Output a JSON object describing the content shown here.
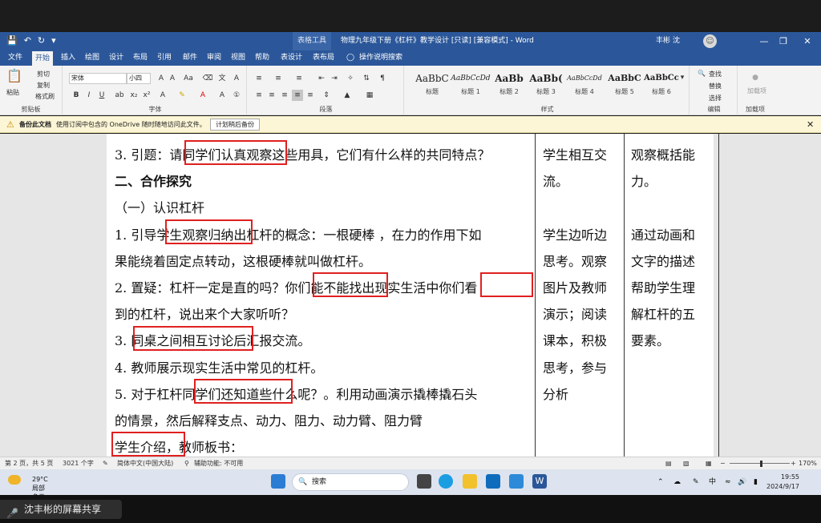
{
  "titlebar": {
    "context_tab": "表格工具",
    "doc_title": "物理九年级下册《杠杆》教学设计 [只读] [兼容模式] - Word",
    "user": "丰彬 沈",
    "minimize": "—",
    "restore": "❐",
    "close": "✕"
  },
  "tabs": [
    "文件",
    "开始",
    "插入",
    "绘图",
    "设计",
    "布局",
    "引用",
    "邮件",
    "审阅",
    "视图",
    "帮助",
    "表设计",
    "表布局"
  ],
  "tell_me": "操作说明搜索",
  "ribbon": {
    "clipboard": {
      "label": "剪贴板",
      "paste": "粘贴",
      "cut": "剪切",
      "copy": "复制",
      "format_painter": "格式刷"
    },
    "font": {
      "label": "字体",
      "font_name": "宋体",
      "font_size": "小四"
    },
    "paragraph": {
      "label": "段落"
    },
    "styles": {
      "label": "样式",
      "items": [
        {
          "preview": "AaBbC",
          "name": "标题"
        },
        {
          "preview": "AaBbCcDd",
          "name": "标题 1"
        },
        {
          "preview": "AaBb",
          "name": "标题 2"
        },
        {
          "preview": "AaBb(",
          "name": "标题 3"
        },
        {
          "preview": "AaBbCcDd",
          "name": "标题 4"
        },
        {
          "preview": "AaBbC",
          "name": "标题 5"
        },
        {
          "preview": "AaBbCc",
          "name": "标题 6"
        }
      ]
    },
    "editing": {
      "label": "编辑",
      "find": "查找",
      "replace": "替换",
      "select": "选择"
    },
    "addins": {
      "label": "加载项",
      "item": "加载项"
    }
  },
  "message_bar": {
    "title": "备份此文档",
    "text": "使用订阅中包含的 OneDrive 随时随地访问此文件。",
    "button": "计划稍后备份"
  },
  "document": {
    "col1": [
      "3. 引题：请同学们认真观察这些用具，它们有什么样的共同特点？",
      "二、合作探究",
      "（一）认识杠杆",
      "1. 引导学生观察归纳出杠杆的概念：一根硬棒 ，在力的作用下如",
      "果能绕着固定点转动，这根硬棒就叫做杠杆。",
      "2. 置疑：杠杆一定是直的吗？你们能不能找出现实生活中你们看",
      "到的杠杆，说出来个大家听听？",
      "3. 同桌之间相互讨论后汇报交流。",
      "4. 教师展示现实生活中常见的杠杆。",
      "5. 对于杠杆同学们还知道些什么呢？。利用动画演示撬棒撬石头",
      "的情景，然后解释支点、动力、阻力、动力臂、阻力臂",
      "学生介绍，教师板书："
    ],
    "col2": [
      "学生相互交",
      "流。",
      "",
      "学生边听边",
      "思考。观察",
      "图片及教师",
      "演示；阅读",
      "课本，积极",
      "思考，参与",
      "分析",
      "",
      ""
    ],
    "col3": [
      "观察概括能",
      "力。",
      "",
      "通过动画和",
      "文字的描述",
      "帮助学生理",
      "解杠杆的五",
      "要素。",
      "",
      "",
      "",
      ""
    ]
  },
  "statusbar": {
    "page": "第 2 页，共 5 页",
    "words": "3021 个字",
    "language": "简体中文(中国大陆)",
    "accessibility": "辅助功能: 不可用",
    "zoom": "170%"
  },
  "taskbar": {
    "temp": "29°C",
    "weather": "局部多云",
    "search": "搜索",
    "ime": "中",
    "time": "19:55",
    "date": "2024/9/17"
  },
  "share_pill": "沈丰彬的屏幕共享"
}
